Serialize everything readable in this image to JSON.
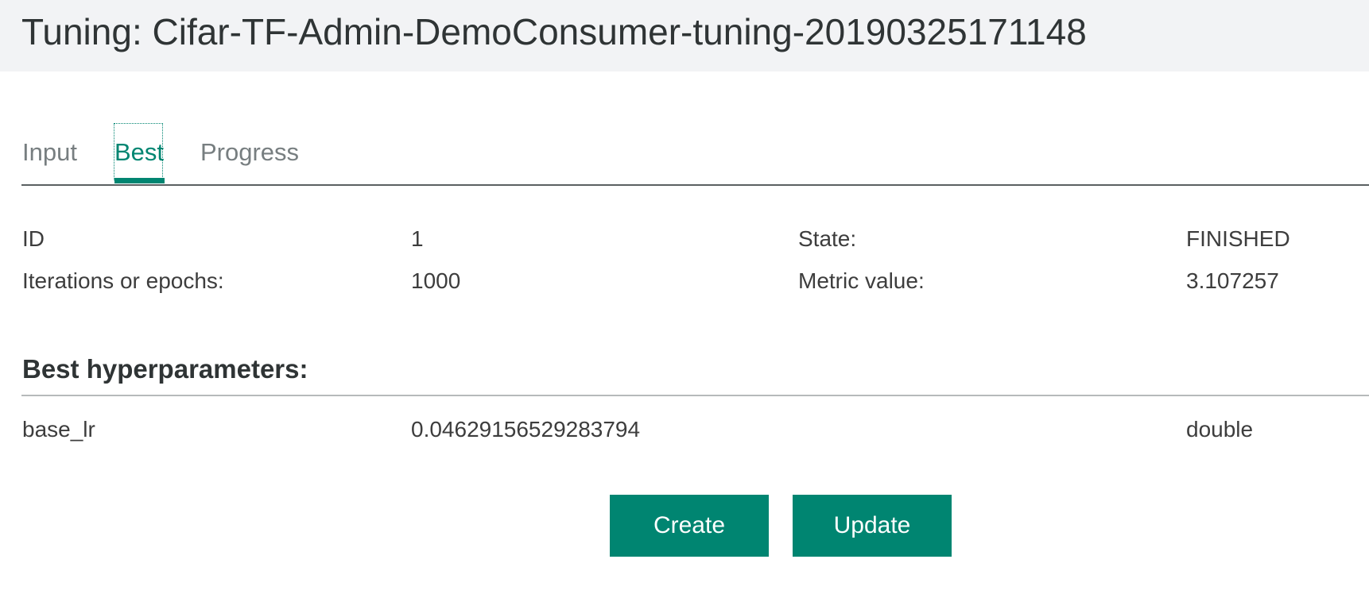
{
  "header": {
    "title": "Tuning: Cifar-TF-Admin-DemoConsumer-tuning-20190325171148"
  },
  "tabs": [
    {
      "label": "Input",
      "active": false
    },
    {
      "label": "Best",
      "active": true
    },
    {
      "label": "Progress",
      "active": false
    }
  ],
  "summary": {
    "id_label": "ID",
    "id_value": "1",
    "state_label": "State:",
    "state_value": "FINISHED",
    "iterations_label": "Iterations or epochs:",
    "iterations_value": "1000",
    "metric_label": "Metric value:",
    "metric_value": "3.107257"
  },
  "hyperparameters": {
    "title": "Best hyperparameters:",
    "rows": [
      {
        "name": "base_lr",
        "value": "0.04629156529283794",
        "type": "double"
      }
    ]
  },
  "actions": {
    "create_label": "Create",
    "update_label": "Update"
  },
  "colors": {
    "accent": "#008571",
    "header_bg": "#f2f3f5"
  }
}
